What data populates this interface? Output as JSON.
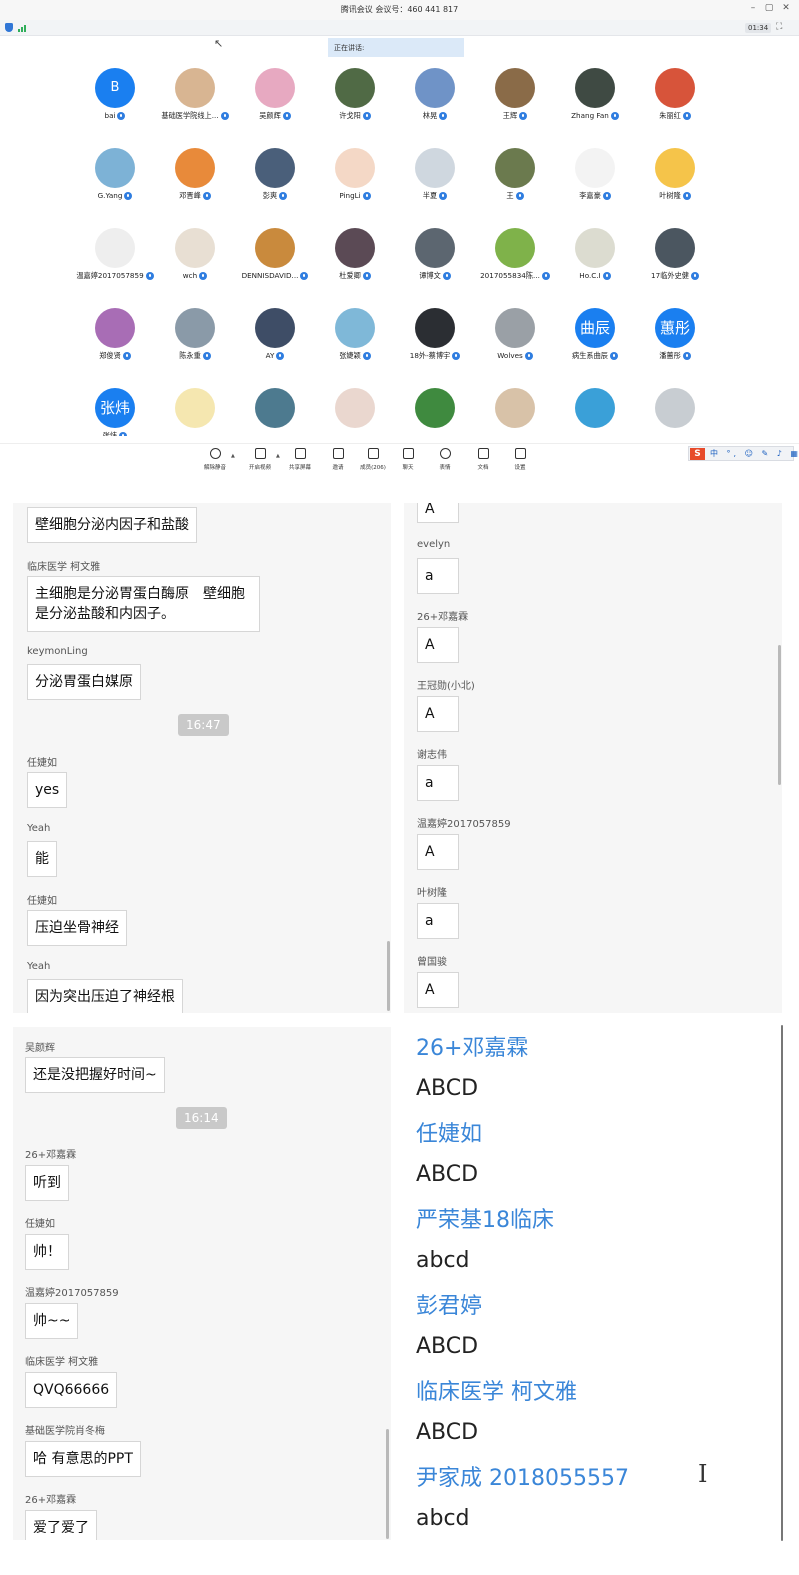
{
  "meeting": {
    "title": "腾讯会议  会议号：460 441 817",
    "window_controls": [
      "–",
      "▢",
      "✕"
    ],
    "timer": "01:34",
    "speaking_label": "正在讲话:",
    "participants": [
      {
        "name": "bai",
        "avatar_text": "B"
      },
      {
        "name": "基础医学院线上...",
        "avatar_color": "#d8b592"
      },
      {
        "name": "吴颜辉",
        "avatar_color": "#e7a9c1"
      },
      {
        "name": "许戈阳",
        "avatar_color": "#506a45"
      },
      {
        "name": "林晃",
        "avatar_color": "#6f93c7"
      },
      {
        "name": "王辉",
        "avatar_color": "#8a6b48"
      },
      {
        "name": "Zhang Fan",
        "avatar_color": "#3f4a43"
      },
      {
        "name": "朱丽红",
        "avatar_color": "#d7543a"
      },
      {
        "name": "G.Yang",
        "avatar_color": "#7db2d6"
      },
      {
        "name": "邓晋峰",
        "avatar_color": "#e88a3a"
      },
      {
        "name": "彭爽",
        "avatar_color": "#4a5f7a"
      },
      {
        "name": "PingLi",
        "avatar_color": "#f4d8c6"
      },
      {
        "name": "半夏",
        "avatar_color": "#cfd7df"
      },
      {
        "name": "王",
        "avatar_color": "#6b7a4e"
      },
      {
        "name": "李嘉豪",
        "avatar_color": "#f3f3f3"
      },
      {
        "name": "叶树隆",
        "avatar_color": "#f5c44a"
      },
      {
        "name": "温嘉婷2017057859",
        "avatar_color": "#eeeeee"
      },
      {
        "name": "wch",
        "avatar_color": "#e8dfd3"
      },
      {
        "name": "DENNISDAVID...",
        "avatar_color": "#c98a3d"
      },
      {
        "name": "杜爱卿",
        "avatar_color": "#5b4a55"
      },
      {
        "name": "谭博文",
        "avatar_color": "#5c6670"
      },
      {
        "name": "2017055834陈...",
        "avatar_color": "#7fb24a"
      },
      {
        "name": "Ho.C.I",
        "avatar_color": "#dcdcd0"
      },
      {
        "name": "17临外史健",
        "avatar_color": "#4b5660"
      },
      {
        "name": "郑俊贤",
        "avatar_color": "#a86db5"
      },
      {
        "name": "陈永重",
        "avatar_color": "#8a9aa8"
      },
      {
        "name": "AY",
        "avatar_color": "#3e4d66"
      },
      {
        "name": "张婕颖",
        "avatar_color": "#7fb8d8"
      },
      {
        "name": "18外-蔡博宇",
        "avatar_color": "#2b2e33"
      },
      {
        "name": "Wolves",
        "avatar_color": "#9aa0a6"
      },
      {
        "name": "病生系曲辰",
        "avatar_text": "曲辰"
      },
      {
        "name": "潘蕙彤",
        "avatar_text": "蕙彤"
      },
      {
        "name": "张炜",
        "avatar_text": "张炜"
      },
      {
        "name": "",
        "avatar_color": "#f5e7b0"
      },
      {
        "name": "",
        "avatar_color": "#4d7a8f"
      },
      {
        "name": "",
        "avatar_color": "#ead7cf"
      },
      {
        "name": "",
        "avatar_color": "#3f8a3f"
      },
      {
        "name": "",
        "avatar_color": "#d8c2a8"
      },
      {
        "name": "",
        "avatar_color": "#3aa0d8"
      },
      {
        "name": "",
        "avatar_color": "#c8cdd2"
      }
    ],
    "toolbar": [
      {
        "label": "解除静音",
        "icon": "mic-icon"
      },
      {
        "label": "开启视频",
        "icon": "camera-icon"
      },
      {
        "label": "共享屏幕",
        "icon": "screen-share-icon"
      },
      {
        "label": "邀请",
        "icon": "invite-icon"
      },
      {
        "label": "成员(206)",
        "icon": "members-icon"
      },
      {
        "label": "聊天",
        "icon": "chat-icon"
      },
      {
        "label": "表情",
        "icon": "emoji-icon"
      },
      {
        "label": "文档",
        "icon": "document-icon"
      },
      {
        "label": "设置",
        "icon": "settings-icon"
      }
    ],
    "ime": {
      "logo": "S",
      "items": "中 °, ☺ ✎ ♪ ▦"
    }
  },
  "chat1": {
    "messages": [
      {
        "sender": "",
        "text": "壁细胞分泌内因子和盐酸"
      },
      {
        "sender": "临床医学 柯文雅",
        "text": "主细胞是分泌胃蛋白酶原　壁细胞是分泌盐酸和内因子。"
      },
      {
        "sender": "keymonLing",
        "text": "分泌胃蛋白媒原"
      },
      {
        "sender": "任婕如",
        "text": "yes"
      },
      {
        "sender": "Yeah",
        "text": "能"
      },
      {
        "sender": "任婕如",
        "text": "压迫坐骨神经"
      },
      {
        "sender": "Yeah",
        "text": "因为突出压迫了神经根"
      }
    ],
    "timestamp": "16:47"
  },
  "chat2": {
    "messages": [
      {
        "sender": "",
        "text": "A"
      },
      {
        "sender": "evelyn",
        "text": "a"
      },
      {
        "sender": "26+邓嘉霖",
        "text": "A"
      },
      {
        "sender": "王冠勋(小北)",
        "text": "A"
      },
      {
        "sender": "谢志伟",
        "text": "a"
      },
      {
        "sender": "温嘉婷2017057859",
        "text": "A"
      },
      {
        "sender": "叶树隆",
        "text": "a"
      },
      {
        "sender": "曾国骏",
        "text": "A"
      }
    ]
  },
  "chat3": {
    "messages": [
      {
        "sender": "吴颜辉",
        "text": "还是没把握好时间~"
      },
      {
        "sender": "26+邓嘉霖",
        "text": "听到"
      },
      {
        "sender": "任婕如",
        "text": "帅！"
      },
      {
        "sender": "温嘉婷2017057859",
        "text": "帅~~"
      },
      {
        "sender": "临床医学 柯文雅",
        "text": "QVQ66666"
      },
      {
        "sender": "基础医学院肖冬梅",
        "text": "哈 有意思的PPT"
      },
      {
        "sender": "26+邓嘉霖",
        "text": "爱了爱了"
      }
    ],
    "timestamp": "16:14"
  },
  "chat4": {
    "messages": [
      {
        "sender": "26+邓嘉霖",
        "text": "ABCD"
      },
      {
        "sender": "任婕如",
        "text": "ABCD"
      },
      {
        "sender": "严荣基18临床",
        "text": "abcd"
      },
      {
        "sender": "彭君婷",
        "text": "ABCD"
      },
      {
        "sender": "临床医学 柯文雅",
        "text": "ABCD"
      },
      {
        "sender": "尹家成 2018055557",
        "text": "abcd"
      }
    ],
    "cursor_glyph": "I"
  },
  "colors": {
    "accent": "#1a7ff0",
    "bubble_border": "#d6d6d6",
    "panel_bg": "#f6f6f6",
    "sender_blue": "#3a86d8"
  }
}
